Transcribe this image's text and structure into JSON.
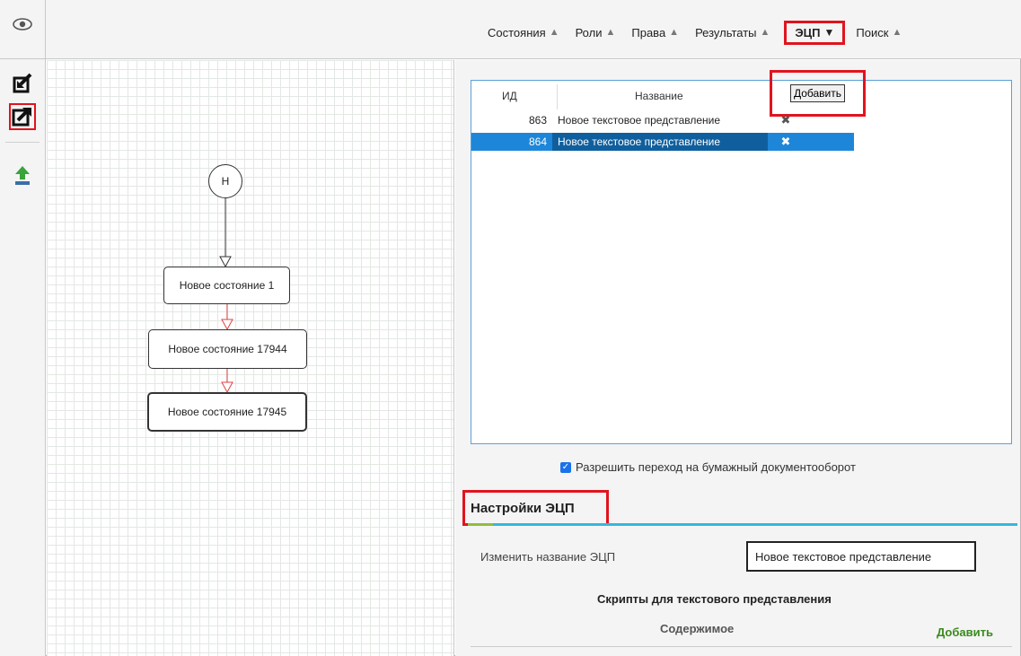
{
  "menu": {
    "items": [
      {
        "label": "Состояния",
        "chevron": "▲"
      },
      {
        "label": "Роли",
        "chevron": "▲"
      },
      {
        "label": "Права",
        "chevron": "▲"
      },
      {
        "label": "Результаты",
        "chevron": "▲"
      },
      {
        "label": "ЭЦП",
        "chevron": "▼",
        "active": true
      },
      {
        "label": "Поиск",
        "chevron": "▲"
      }
    ]
  },
  "icons": {
    "eye": "eye-icon",
    "tools": [
      "import-icon",
      "export-icon",
      "upload-icon"
    ]
  },
  "diagram": {
    "start_label": "Н",
    "nodes": [
      "Новое состояние 1",
      "Новое состояние 17944",
      "Новое состояние 17945"
    ]
  },
  "table": {
    "headers": {
      "id": "ИД",
      "name": "Название"
    },
    "add_button": "Добавить",
    "rows": [
      {
        "id": "863",
        "name": "Новое текстовое представление",
        "delete": "✖"
      },
      {
        "id": "864",
        "name": "Новое текстовое представление",
        "delete": "✖",
        "selected": true
      }
    ]
  },
  "checkbox": {
    "label": "Разрешить переход на бумажный документооборот",
    "checked": true
  },
  "settings": {
    "title": "Настройки ЭЦП",
    "rename_label": "Изменить название ЭЦП",
    "rename_value": "Новое текстовое представление",
    "scripts_title": "Скрипты для текстового представления",
    "content_label": "Содержимое",
    "content_add": "Добавить"
  },
  "colors": {
    "accent": "#1e86d8",
    "highlight": "#e0141e",
    "underline": "#33b8e0",
    "add_green": "#3a8a1e"
  }
}
